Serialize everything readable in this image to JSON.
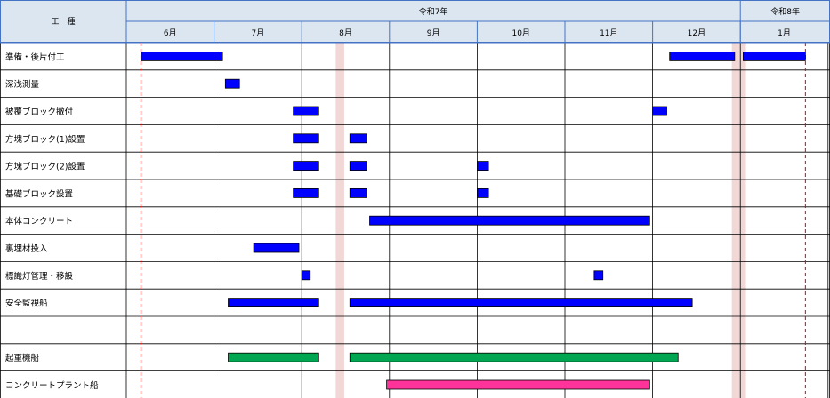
{
  "header": {
    "work_label": "工　種",
    "year_groups": [
      {
        "label": "令和7年"
      },
      {
        "label": "令和8年"
      }
    ]
  },
  "chart_data": {
    "type": "gantt",
    "months": [
      "6月",
      "7月",
      "8月",
      "9月",
      "10月",
      "11月",
      "12月",
      "1月"
    ],
    "period_start": "2025-06-06",
    "period_end": "2026-01-24",
    "holiday_periods": [
      {
        "start": "2025-08-13",
        "end": "2025-08-16"
      },
      {
        "start": "2025-12-29",
        "end": "2026-01-03"
      }
    ],
    "colors": {
      "blue": "#0000ff",
      "green": "#00a651",
      "pink": "#ff3399",
      "holiday": "#f2d7d7",
      "header_bg": "#dce6f1",
      "header_border": "#4472c4"
    },
    "tasks": [
      {
        "name": "準備・後片付工",
        "bars": [
          {
            "start": "2025-06-06",
            "end": "2025-07-04",
            "color": "blue"
          },
          {
            "start": "2025-12-07",
            "end": "2025-12-30",
            "color": "blue"
          },
          {
            "start": "2026-01-02",
            "end": "2026-01-24",
            "color": "blue"
          }
        ]
      },
      {
        "name": "深浅測量",
        "bars": [
          {
            "start": "2025-07-05",
            "end": "2025-07-10",
            "color": "blue"
          }
        ]
      },
      {
        "name": "被覆ブロック撤付",
        "bars": [
          {
            "start": "2025-07-29",
            "end": "2025-08-07",
            "color": "blue"
          },
          {
            "start": "2025-12-01",
            "end": "2025-12-06",
            "color": "blue"
          }
        ]
      },
      {
        "name": "方塊ブロック(1)設置",
        "bars": [
          {
            "start": "2025-07-29",
            "end": "2025-08-07",
            "color": "blue"
          },
          {
            "start": "2025-08-18",
            "end": "2025-08-24",
            "color": "blue"
          }
        ]
      },
      {
        "name": "方塊ブロック(2)設置",
        "bars": [
          {
            "start": "2025-07-29",
            "end": "2025-08-07",
            "color": "blue"
          },
          {
            "start": "2025-08-18",
            "end": "2025-08-24",
            "color": "blue"
          },
          {
            "start": "2025-10-01",
            "end": "2025-10-05",
            "color": "blue"
          }
        ]
      },
      {
        "name": "基礎ブロック設置",
        "bars": [
          {
            "start": "2025-07-29",
            "end": "2025-08-07",
            "color": "blue"
          },
          {
            "start": "2025-08-18",
            "end": "2025-08-24",
            "color": "blue"
          },
          {
            "start": "2025-10-01",
            "end": "2025-10-05",
            "color": "blue"
          }
        ]
      },
      {
        "name": "本体コンクリート",
        "bars": [
          {
            "start": "2025-08-25",
            "end": "2025-11-30",
            "color": "blue"
          }
        ]
      },
      {
        "name": "裏埋材投入",
        "bars": [
          {
            "start": "2025-07-15",
            "end": "2025-07-31",
            "color": "blue"
          }
        ]
      },
      {
        "name": "標識灯管理・移設",
        "bars": [
          {
            "start": "2025-08-01",
            "end": "2025-08-04",
            "color": "blue"
          },
          {
            "start": "2025-11-11",
            "end": "2025-11-14",
            "color": "blue"
          }
        ]
      },
      {
        "name": "安全監視船",
        "bars": [
          {
            "start": "2025-07-06",
            "end": "2025-08-07",
            "color": "blue"
          },
          {
            "start": "2025-08-18",
            "end": "2025-12-15",
            "color": "blue"
          }
        ]
      },
      {
        "name": "",
        "bars": []
      },
      {
        "name": "起重機船",
        "bars": [
          {
            "start": "2025-07-06",
            "end": "2025-08-07",
            "color": "green"
          },
          {
            "start": "2025-08-18",
            "end": "2025-12-10",
            "color": "green"
          }
        ]
      },
      {
        "name": "コンクリートプラント船",
        "bars": [
          {
            "start": "2025-08-31",
            "end": "2025-11-30",
            "color": "pink"
          }
        ]
      }
    ]
  }
}
